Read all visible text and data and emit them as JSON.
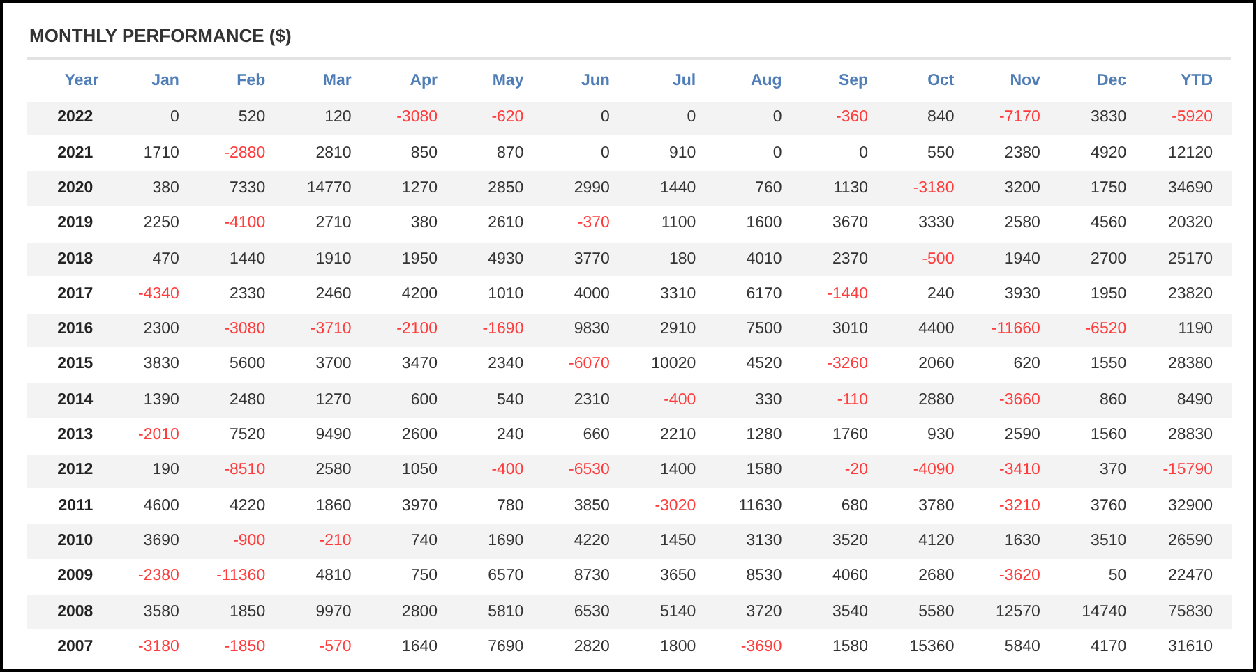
{
  "title": "MONTHLY PERFORMANCE ($)",
  "columns": [
    "Year",
    "Jan",
    "Feb",
    "Mar",
    "Apr",
    "May",
    "Jun",
    "Jul",
    "Aug",
    "Sep",
    "Oct",
    "Nov",
    "Dec",
    "YTD"
  ],
  "rows": [
    {
      "year": "2022",
      "values": [
        "0",
        "520",
        "120",
        "-3080",
        "-620",
        "0",
        "0",
        "0",
        "-360",
        "840",
        "-7170",
        "3830",
        "-5920"
      ],
      "negative": [
        false,
        false,
        false,
        true,
        true,
        false,
        false,
        false,
        true,
        false,
        true,
        false,
        true
      ]
    },
    {
      "year": "2021",
      "values": [
        "1710",
        "-2880",
        "2810",
        "850",
        "870",
        "0",
        "910",
        "0",
        "0",
        "550",
        "2380",
        "4920",
        "12120"
      ],
      "negative": [
        false,
        true,
        false,
        false,
        false,
        false,
        false,
        false,
        false,
        false,
        false,
        false,
        false
      ]
    },
    {
      "year": "2020",
      "values": [
        "380",
        "7330",
        "14770",
        "1270",
        "2850",
        "2990",
        "1440",
        "760",
        "1130",
        "-3180",
        "3200",
        "1750",
        "34690"
      ],
      "negative": [
        false,
        false,
        false,
        false,
        false,
        false,
        false,
        false,
        false,
        true,
        false,
        false,
        false
      ]
    },
    {
      "year": "2019",
      "values": [
        "2250",
        "-4100",
        "2710",
        "380",
        "2610",
        "-370",
        "1100",
        "1600",
        "3670",
        "3330",
        "2580",
        "4560",
        "20320"
      ],
      "negative": [
        false,
        true,
        false,
        false,
        false,
        true,
        false,
        false,
        false,
        false,
        false,
        false,
        false
      ]
    },
    {
      "year": "2018",
      "values": [
        "470",
        "1440",
        "1910",
        "1950",
        "4930",
        "3770",
        "180",
        "4010",
        "2370",
        "-500",
        "1940",
        "2700",
        "25170"
      ],
      "negative": [
        false,
        false,
        false,
        false,
        false,
        false,
        false,
        false,
        false,
        true,
        false,
        false,
        false
      ]
    },
    {
      "year": "2017",
      "values": [
        "-4340",
        "2330",
        "2460",
        "4200",
        "1010",
        "4000",
        "3310",
        "6170",
        "-1440",
        "240",
        "3930",
        "1950",
        "23820"
      ],
      "negative": [
        true,
        false,
        false,
        false,
        false,
        false,
        false,
        false,
        true,
        false,
        false,
        false,
        false
      ]
    },
    {
      "year": "2016",
      "values": [
        "2300",
        "-3080",
        "-3710",
        "-2100",
        "-1690",
        "9830",
        "2910",
        "7500",
        "3010",
        "4400",
        "-11660",
        "-6520",
        "1190"
      ],
      "negative": [
        false,
        true,
        true,
        true,
        true,
        false,
        false,
        false,
        false,
        false,
        true,
        true,
        false
      ]
    },
    {
      "year": "2015",
      "values": [
        "3830",
        "5600",
        "3700",
        "3470",
        "2340",
        "-6070",
        "10020",
        "4520",
        "-3260",
        "2060",
        "620",
        "1550",
        "28380"
      ],
      "negative": [
        false,
        false,
        false,
        false,
        false,
        true,
        false,
        false,
        true,
        false,
        false,
        false,
        false
      ]
    },
    {
      "year": "2014",
      "values": [
        "1390",
        "2480",
        "1270",
        "600",
        "540",
        "2310",
        "-400",
        "330",
        "-110",
        "2880",
        "-3660",
        "860",
        "8490"
      ],
      "negative": [
        false,
        false,
        false,
        false,
        false,
        false,
        true,
        false,
        true,
        false,
        true,
        false,
        false
      ]
    },
    {
      "year": "2013",
      "values": [
        "-2010",
        "7520",
        "9490",
        "2600",
        "240",
        "660",
        "2210",
        "1280",
        "1760",
        "930",
        "2590",
        "1560",
        "28830"
      ],
      "negative": [
        true,
        false,
        false,
        false,
        false,
        false,
        false,
        false,
        false,
        false,
        false,
        false,
        false
      ]
    },
    {
      "year": "2012",
      "values": [
        "190",
        "-8510",
        "2580",
        "1050",
        "-400",
        "-6530",
        "1400",
        "1580",
        "-20",
        "-4090",
        "-3410",
        "370",
        "-15790"
      ],
      "negative": [
        false,
        true,
        false,
        false,
        true,
        true,
        false,
        false,
        true,
        true,
        true,
        false,
        true
      ]
    },
    {
      "year": "2011",
      "values": [
        "4600",
        "4220",
        "1860",
        "3970",
        "780",
        "3850",
        "-3020",
        "11630",
        "680",
        "3780",
        "-3210",
        "3760",
        "32900"
      ],
      "negative": [
        false,
        false,
        false,
        false,
        false,
        false,
        true,
        false,
        false,
        false,
        true,
        false,
        false
      ]
    },
    {
      "year": "2010",
      "values": [
        "3690",
        "-900",
        "-210",
        "740",
        "1690",
        "4220",
        "1450",
        "3130",
        "3520",
        "4120",
        "1630",
        "3510",
        "26590"
      ],
      "negative": [
        false,
        true,
        true,
        false,
        false,
        false,
        false,
        false,
        false,
        false,
        false,
        false,
        false
      ]
    },
    {
      "year": "2009",
      "values": [
        "-2380",
        "-11360",
        "4810",
        "750",
        "6570",
        "8730",
        "3650",
        "8530",
        "4060",
        "2680",
        "-3620",
        "50",
        "22470"
      ],
      "negative": [
        true,
        true,
        false,
        false,
        false,
        false,
        false,
        false,
        false,
        false,
        true,
        false,
        false
      ]
    },
    {
      "year": "2008",
      "values": [
        "3580",
        "1850",
        "9970",
        "2800",
        "5810",
        "6530",
        "5140",
        "3720",
        "3540",
        "5580",
        "12570",
        "14740",
        "75830"
      ],
      "negative": [
        false,
        false,
        false,
        false,
        false,
        false,
        false,
        false,
        false,
        false,
        false,
        false,
        false
      ]
    },
    {
      "year": "2007",
      "values": [
        "-3180",
        "-1850",
        "-570",
        "1640",
        "7690",
        "2820",
        "1800",
        "-3690",
        "1580",
        "15360",
        "5840",
        "4170",
        "31610"
      ],
      "negative": [
        true,
        true,
        true,
        false,
        false,
        false,
        false,
        true,
        false,
        false,
        false,
        false,
        false
      ]
    }
  ]
}
